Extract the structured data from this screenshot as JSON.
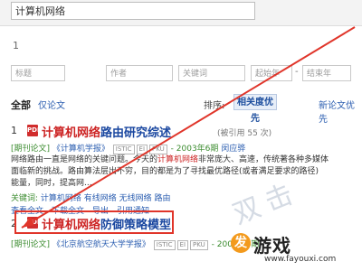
{
  "search": {
    "value": "计算机网络"
  },
  "page_indicator": "1",
  "filters": [
    {
      "placeholder": "标题"
    },
    {
      "placeholder": "作者"
    },
    {
      "placeholder": "关键词"
    },
    {
      "placeholder": "起始年"
    },
    {
      "placeholder": "结束年"
    }
  ],
  "filter_separator": "-",
  "tabs": {
    "all": "全部",
    "papers_only": "仅论文"
  },
  "sort": {
    "label": "排序:",
    "active": "相关度优先",
    "alternative": "新论文优先"
  },
  "results": [
    {
      "number": "1",
      "pdf_icon": "pdf-icon",
      "title_hl": "计算机网络",
      "title_rest": "路由研究综述",
      "cite": "(被引用 55 次)",
      "meta_type": "[期刊论文]",
      "meta_journal": "《计算机学报》",
      "meta_tags": [
        "ISTIC",
        "EI",
        "PKU"
      ],
      "meta_issue": "- 2003年6期",
      "meta_author": "闵应骅",
      "snippet_1": "网络路由一直是网络的关键问题。今天的",
      "snippet_hl": "计算机网络",
      "snippet_2": "非常庞大、高速，传统著各种多媒体",
      "snippet_line2": "面临新的挑战。路由算法层出不穷，目的都是为了寻找最优路径(或者满足要求的路径)",
      "snippet_line3": "能量，同时，提高网...",
      "kw_label": "关键词:",
      "keywords": "计算机网络  有线网络  无线网络  路由",
      "act_view": "查看全文",
      "act_download": "下载全文",
      "act_export": "导出",
      "act_cite": "引用通知"
    },
    {
      "number": "2",
      "pdf_icon": "pdf-icon",
      "title_hl": "计算机网络",
      "title_rest": "防御策略模型",
      "meta_type": "[期刊论文]",
      "meta_journal": "《北京航空航天大学学报》",
      "meta_tags": [
        "ISTIC",
        "EI",
        "PKU"
      ],
      "meta_issue": "- 2006年6期"
    }
  ],
  "annotation": {
    "handwriting": "双击",
    "color": "#e0352a"
  },
  "watermark": {
    "logo_char": "发",
    "text": "游戏",
    "url": "www.fayouxi.com",
    "accent": "#f39a1d"
  }
}
